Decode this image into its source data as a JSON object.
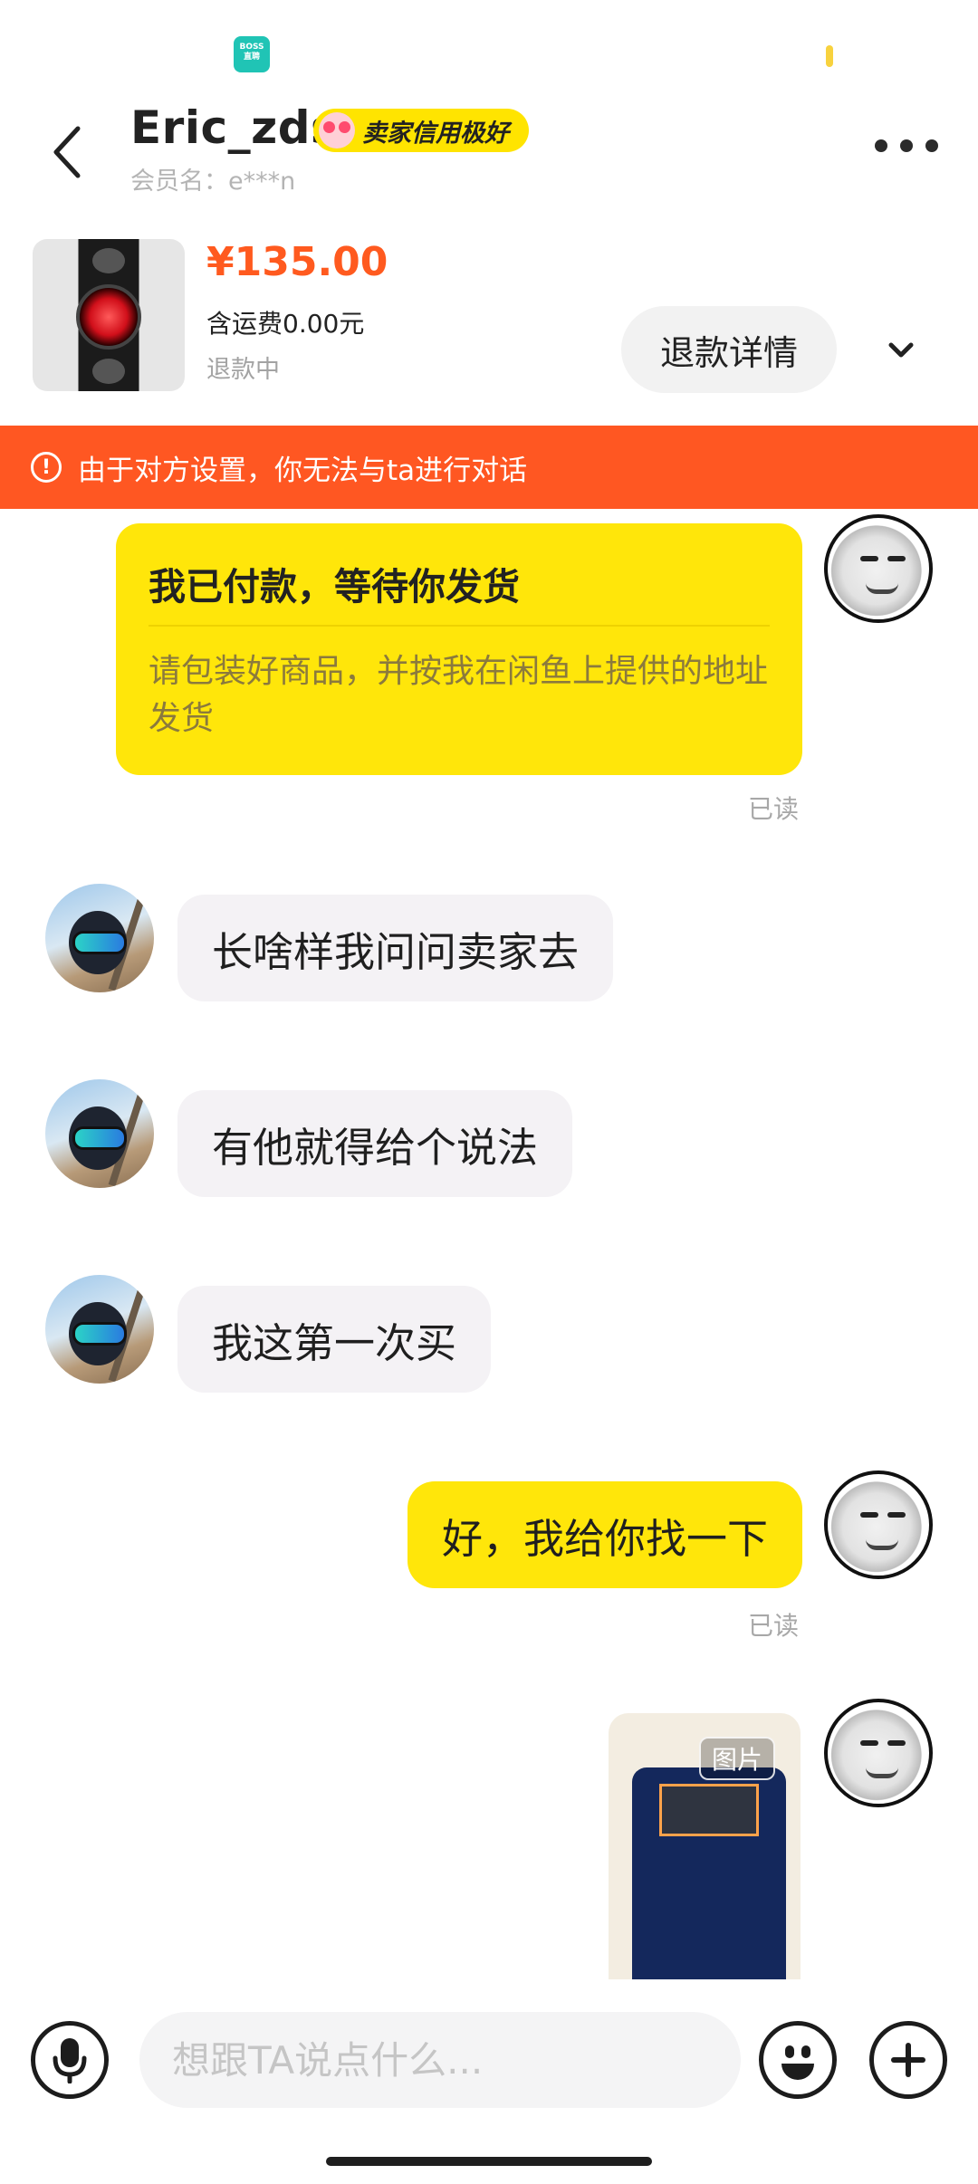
{
  "status_bar": {
    "app_chip_text": "BOSS\n直聘"
  },
  "header": {
    "title": "Eric_zds",
    "credit_badge": "卖家信用极好",
    "member_name": "会员名：e***n"
  },
  "product": {
    "price": "¥135.00",
    "shipping": "含运费0.00元",
    "status": "退款中",
    "refund_button": "退款详情"
  },
  "banner": {
    "icon": "!",
    "text": "由于对方设置，你无法与ta进行对话"
  },
  "messages": {
    "paid_card_title": "我已付款，等待你发货",
    "paid_card_desc": "请包装好商品，并按我在闲鱼上提供的地址发货",
    "read_1": "已读",
    "msg_1": "长啥样我问问卖家去",
    "msg_2": "有他就得给个说法",
    "msg_3": "我这第一次买",
    "msg_4": "好，我给你找一下",
    "read_2": "已读",
    "photo_tag": "图片"
  },
  "input": {
    "placeholder": "想跟TA说点什么..."
  },
  "icons": {
    "back": "chevron-left-icon",
    "more": "more-dots-icon",
    "expand": "chevron-down-icon",
    "warning": "warning-circle-icon",
    "voice": "microphone-icon",
    "emoji": "emoji-icon",
    "add": "plus-circle-icon"
  },
  "colors": {
    "accent_yellow": "#ffe60a",
    "banner_orange": "#ff5722",
    "price_orange": "#ff5a1f"
  }
}
